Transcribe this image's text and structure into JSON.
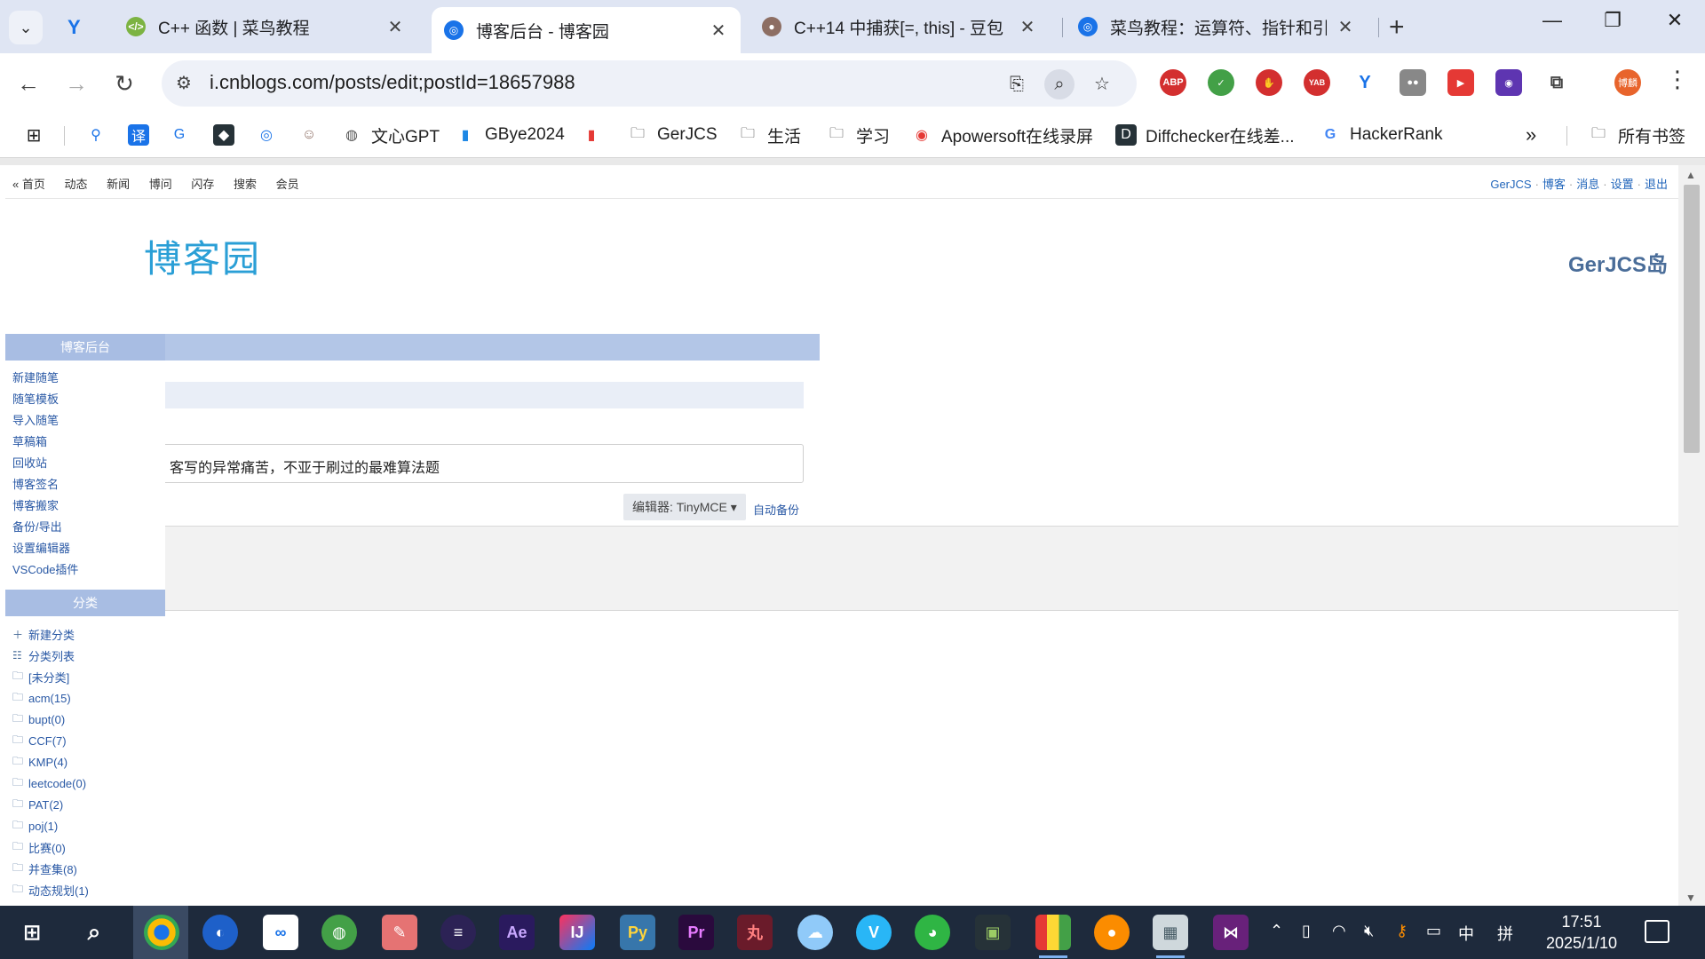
{
  "browser": {
    "tabs": [
      {
        "label": "C++ 函数 | 菜鸟教程",
        "color": "#7cb342",
        "glyph": "</>"
      },
      {
        "label": "博客后台 - 博客园",
        "color": "#1a73e8",
        "glyph": "◎"
      },
      {
        "label": "C++14 中捕获[=, this] - 豆包",
        "color": "#8d6e63",
        "glyph": "●"
      },
      {
        "label": "菜鸟教程：运算符、指针和引用",
        "color": "#1a73e8",
        "glyph": "◎"
      }
    ],
    "url": "i.cnblogs.com/posts/edit;postId=18657988",
    "profile_label": "博麟",
    "bookmarks": {
      "wenxin": "文心GPT",
      "gbye": "GBye2024",
      "gerjcs": "GerJCS",
      "life": "生活",
      "study": "学习",
      "apowersoft": "Apowersoft在线录屏",
      "diffchecker": "Diffchecker在线差...",
      "hackerrank": "HackerRank",
      "all": "所有书签"
    },
    "extensions": {
      "abp": "ABP",
      "yab": "YAB"
    }
  },
  "page": {
    "topnav_left": [
      "« 首页",
      "动态",
      "新闻",
      "博问",
      "闪存",
      "搜索",
      "会员"
    ],
    "topnav_right": [
      "GerJCS",
      "博客",
      "消息",
      "设置",
      "退出"
    ],
    "logo_text": "博客园",
    "blog_name": "GerJCS岛",
    "sidebar": {
      "header_admin": "博客后台",
      "admin_links": [
        "新建随笔",
        "随笔模板",
        "导入随笔",
        "草稿箱",
        "回收站",
        "博客签名",
        "博客搬家",
        "备份/导出",
        "设置编辑器",
        "VSCode插件"
      ],
      "header_category": "分类",
      "category_actions": [
        "新建分类",
        "分类列表"
      ],
      "categories": [
        "[未分类]",
        "acm(15)",
        "bupt(0)",
        "CCF(7)",
        "KMP(4)",
        "leetcode(0)",
        "PAT(2)",
        "poj(1)",
        "比赛(0)",
        "并查集(8)",
        "动态规划(1)"
      ]
    },
    "post_title": "客写的异常痛苦，不亚于刷过的最难算法题",
    "editor_label": "编辑器: TinyMCE",
    "autosave_label": "自动备份"
  },
  "taskbar": {
    "time": "17:51",
    "date": "2025/1/10",
    "ime": "中",
    "ime_mode": "拼"
  }
}
